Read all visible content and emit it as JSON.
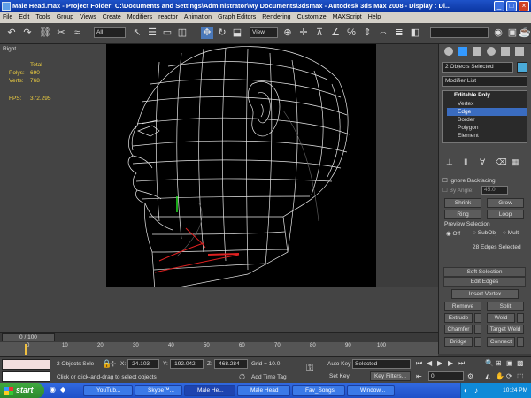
{
  "title_bar": {
    "text": "Male Head.max    - Project Folder: C:\\Documents and Settings\\Administrator\\My Documents\\3dsmax    - Autodesk 3ds Max 2008    - Display : Di...",
    "minimize": "_",
    "maximize": "□",
    "close": "×"
  },
  "menu": [
    "File",
    "Edit",
    "Tools",
    "Group",
    "Views",
    "Create",
    "Modifiers",
    "reactor",
    "Animation",
    "Graph Editors",
    "Rendering",
    "Customize",
    "MAXScript",
    "Help"
  ],
  "toolbar": {
    "selection_filter": "All",
    "ref_coord": "View",
    "named_selection": ""
  },
  "viewport": {
    "label": "Right",
    "stats": {
      "total_label": "Total",
      "polys_label": "Polys:",
      "polys_value": "690",
      "verts_label": "Verts:",
      "verts_value": "768",
      "fps_label": "FPS:",
      "fps_value": "372.295"
    }
  },
  "command_panel": {
    "object_name": "2 Objects Selected",
    "modifier_list": "Modifier List",
    "stack_title": "Editable Poly",
    "stack_items": [
      "Vertex",
      "Edge",
      "Border",
      "Polygon",
      "Element"
    ],
    "active_item": "Edge",
    "ignore_backfacing": "Ignore Backfacing",
    "by_angle_label": "By Angle:",
    "by_angle_value": "45.0",
    "shrink": "Shrink",
    "grow": "Grow",
    "ring": "Ring",
    "loop": "Loop",
    "preview_selection": "Preview Selection",
    "preview_off": "Off",
    "preview_subobj": "SubObj",
    "preview_multi": "Multi",
    "edges_selected": "28 Edges Selected",
    "soft_selection": "Soft Selection",
    "edit_edges": "Edit Edges",
    "insert_vertex": "Insert Vertex",
    "remove": "Remove",
    "split": "Split",
    "extrude": "Extrude",
    "weld": "Weld",
    "chamfer": "Chamfer",
    "target_weld": "Target Weld",
    "bridge": "Bridge",
    "connect": "Connect"
  },
  "timeline": {
    "frame_label": "0 / 100",
    "ticks": [
      "0",
      "10",
      "20",
      "30",
      "40",
      "50",
      "60",
      "70",
      "80",
      "90",
      "100"
    ]
  },
  "status": {
    "selection": "2 Objects Sele",
    "x_label": "X:",
    "x_value": "-24.103",
    "y_label": "Y:",
    "y_value": "-192.042",
    "z_label": "Z:",
    "z_value": "-468.284",
    "grid": "Grid = 10.0",
    "prompt": "Click or click-and-drag to select objects",
    "add_time_tag": "Add Time Tag",
    "auto_key": "Auto Key",
    "key_mode": "Selected",
    "set_key": "Set Key",
    "key_filters": "Key Filters...",
    "frame_value": "0"
  },
  "taskbar": {
    "start": "start",
    "tasks": [
      "YouTub...",
      "Skype™...",
      "Male He...",
      "Male Head",
      "Fav_Songs",
      "Window..."
    ],
    "active_task": "Male He...",
    "clock": "10:24 PM"
  },
  "colors": {
    "title_blue": "#0a34a0",
    "stack_highlight": "#3a6cc0",
    "wire_white": "#e8e8e8",
    "selected_edge": "#e02020",
    "start_green": "#2d8a2d"
  }
}
